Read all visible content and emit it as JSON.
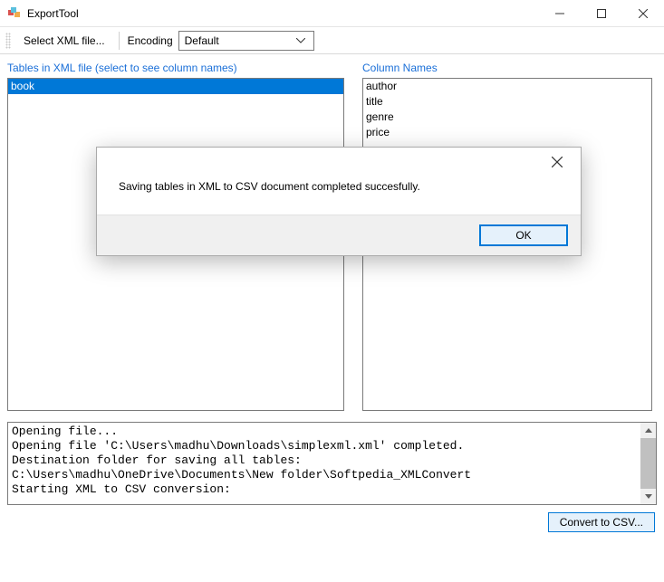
{
  "titlebar": {
    "title": "ExportTool"
  },
  "toolbar": {
    "select_label": "Select XML file...",
    "encoding_label": "Encoding",
    "encoding_value": "Default"
  },
  "headers": {
    "tables": "Tables in XML file (select to see column names)",
    "columns": "Column Names"
  },
  "tables_list": {
    "items": [
      "book"
    ],
    "selected_index": 0
  },
  "columns_list": {
    "items": [
      "author",
      "title",
      "genre",
      "price"
    ]
  },
  "log_lines": [
    "Opening file...",
    "Opening file 'C:\\Users\\madhu\\Downloads\\simplexml.xml' completed.",
    "Destination folder for saving all tables:",
    "C:\\Users\\madhu\\OneDrive\\Documents\\New folder\\Softpedia_XMLConvert",
    "Starting XML to CSV conversion:"
  ],
  "footer": {
    "convert_label": "Convert to CSV..."
  },
  "modal": {
    "message": "Saving tables in XML to CSV document completed succesfully.",
    "ok_label": "OK"
  }
}
